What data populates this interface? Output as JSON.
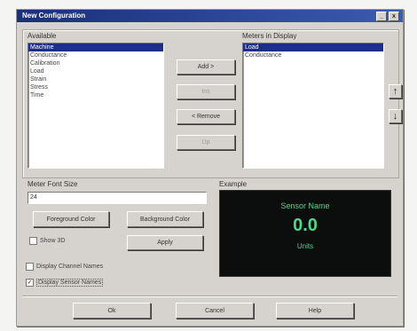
{
  "window": {
    "title": "New Configuration",
    "minimize": "_",
    "close": "x"
  },
  "available": {
    "label": "Available",
    "items": [
      "Machine",
      "Conductance",
      "Calibration",
      "Load",
      "Strain",
      "Stress",
      "Time"
    ]
  },
  "meters": {
    "label": "Meters in Display",
    "items": [
      "Load",
      "Conductance"
    ]
  },
  "actions": {
    "add": "Add >",
    "ins": "Ins",
    "remove": "< Remove",
    "up": "Up"
  },
  "order": {
    "up_glyph": "↑",
    "down_glyph": "↓"
  },
  "font": {
    "label": "Meter Font Size",
    "value": "24",
    "foreground": "Foreground Color",
    "background": "Background Color",
    "show3d": "Show 3D",
    "apply": "Apply",
    "display_channel_names": "Display Channel Names",
    "display_sensor_names": "Display Sensor Names",
    "display_sensor_names_checked": "✓"
  },
  "example": {
    "label": "Example",
    "name": "Sensor Name",
    "value": "0.0",
    "units": "Units"
  },
  "footer": {
    "ok": "Ok",
    "cancel": "Cancel",
    "help": "Help"
  },
  "colors": {
    "title_bar": "#1a2f7a",
    "selection": "#1c2f86",
    "example_bg": "#0c0e0e",
    "example_fg": "#4ed88a"
  }
}
